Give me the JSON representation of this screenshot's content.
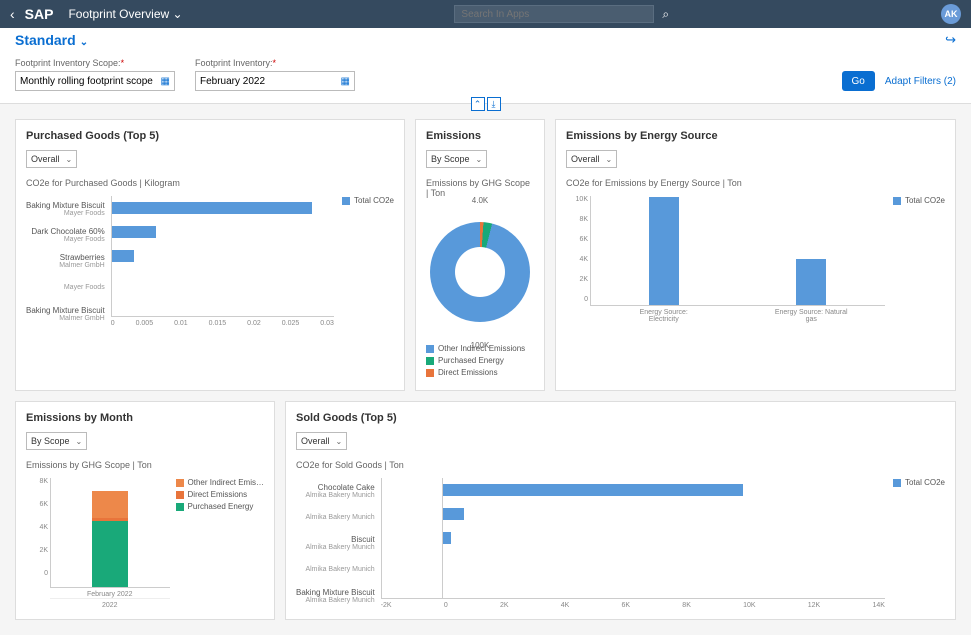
{
  "header": {
    "title": "Footprint Overview",
    "search_placeholder": "Search In Apps",
    "avatar": "AK"
  },
  "variant": {
    "name": "Standard"
  },
  "filters": {
    "scope_label": "Footprint Inventory Scope:",
    "scope_value": "Monthly rolling footprint scope",
    "inventory_label": "Footprint Inventory:",
    "inventory_value": "February 2022",
    "go": "Go",
    "adapt": "Adapt Filters (2)"
  },
  "cards": {
    "purchased": {
      "title": "Purchased Goods (Top 5)",
      "select": "Overall",
      "subtitle": "CO2e for Purchased Goods | Kilogram",
      "legend": "Total CO2e"
    },
    "emissions": {
      "title": "Emissions",
      "select": "By Scope",
      "subtitle": "Emissions by GHG Scope | Ton",
      "top_label": "4.0K",
      "bot_label": "100K",
      "legend1": "Other Indirect Emissions",
      "legend2": "Purchased Energy",
      "legend3": "Direct Emissions"
    },
    "energy": {
      "title": "Emissions by Energy Source",
      "select": "Overall",
      "subtitle": "CO2e for Emissions by Energy Source | Ton",
      "legend": "Total CO2e"
    },
    "bymonth": {
      "title": "Emissions by Month",
      "select": "By Scope",
      "subtitle": "Emissions by GHG Scope | Ton",
      "legend1": "Other Indirect Emis…",
      "legend2": "Direct Emissions",
      "legend3": "Purchased Energy",
      "xlabel1": "February 2022",
      "xgroup": "2022"
    },
    "sold": {
      "title": "Sold Goods (Top 5)",
      "select": "Overall",
      "subtitle": "CO2e for Sold Goods | Ton",
      "legend": "Total CO2e"
    }
  },
  "chart_data": [
    {
      "id": "purchased_goods",
      "type": "bar",
      "orientation": "horizontal",
      "title": "CO2e for Purchased Goods | Kilogram",
      "xlabel": "",
      "ylabel": "",
      "xlim": [
        0,
        0.03
      ],
      "xticks": [
        0,
        0.005,
        0.01,
        0.015,
        0.02,
        0.025,
        0.03
      ],
      "categories": [
        {
          "name": "Baking Mixture Biscuit",
          "sub": "Mayer Foods"
        },
        {
          "name": "Dark Chocolate 60%",
          "sub": "Mayer Foods"
        },
        {
          "name": "Strawberries",
          "sub": "Malmer GmbH"
        },
        {
          "name": "",
          "sub": "Mayer Foods"
        },
        {
          "name": "Baking Mixture Biscuit",
          "sub": "Malmer GmbH"
        }
      ],
      "series": [
        {
          "name": "Total CO2e",
          "color": "#5899da",
          "values": [
            0.027,
            0.006,
            0.003,
            0.0,
            0.0
          ]
        }
      ]
    },
    {
      "id": "emissions_scope",
      "type": "pie",
      "title": "Emissions by GHG Scope | Ton",
      "series": [
        {
          "name": "Other Indirect Emissions",
          "value": 100000,
          "color": "#5899da"
        },
        {
          "name": "Purchased Energy",
          "value": 3000,
          "color": "#19a979"
        },
        {
          "name": "Direct Emissions",
          "value": 1000,
          "color": "#e8743b"
        }
      ]
    },
    {
      "id": "energy_source",
      "type": "bar",
      "orientation": "vertical",
      "title": "CO2e for Emissions by Energy Source | Ton",
      "ylim": [
        0,
        10000
      ],
      "yticks": [
        0,
        2000,
        4000,
        6000,
        8000,
        10000
      ],
      "ytick_labels": [
        "0",
        "2K",
        "4K",
        "6K",
        "8K",
        "10K"
      ],
      "categories": [
        "Energy Source: Electricity",
        "Energy Source: Natural gas"
      ],
      "series": [
        {
          "name": "Total CO2e",
          "color": "#5899da",
          "values": [
            9800,
            4200
          ]
        }
      ]
    },
    {
      "id": "emissions_by_month",
      "type": "bar",
      "stacked": true,
      "orientation": "vertical",
      "title": "Emissions by GHG Scope | Ton",
      "ylim": [
        0,
        8000
      ],
      "yticks": [
        0,
        2000,
        4000,
        6000,
        8000
      ],
      "ytick_labels": [
        "0",
        "2K",
        "4K",
        "6K",
        "8K"
      ],
      "categories": [
        "February 2022"
      ],
      "group": "2022",
      "series": [
        {
          "name": "Purchased Energy",
          "color": "#19a979",
          "values": [
            4800
          ]
        },
        {
          "name": "Direct Emissions",
          "color": "#e8743b",
          "values": [
            200
          ]
        },
        {
          "name": "Other Indirect Emis…",
          "color": "#ed884a",
          "values": [
            2000
          ]
        }
      ]
    },
    {
      "id": "sold_goods",
      "type": "bar",
      "orientation": "horizontal",
      "title": "CO2e for Sold Goods | Ton",
      "xlim": [
        -2000,
        14000
      ],
      "xticks": [
        -2000,
        0,
        2000,
        4000,
        6000,
        8000,
        10000,
        12000,
        14000
      ],
      "xtick_labels": [
        "-2K",
        "0",
        "2K",
        "4K",
        "6K",
        "8K",
        "10K",
        "12K",
        "14K"
      ],
      "categories": [
        {
          "name": "Chocolate Cake",
          "sub": "Almika Bakery Munich"
        },
        {
          "name": "",
          "sub": "Almika Bakery Munich"
        },
        {
          "name": "Biscuit",
          "sub": "Almika Bakery Munich"
        },
        {
          "name": "",
          "sub": "Almika Bakery Munich"
        },
        {
          "name": "Baking Mixture Biscuit",
          "sub": "Almika Bakery Munich"
        }
      ],
      "series": [
        {
          "name": "Total CO2e",
          "color": "#5899da",
          "values": [
            9500,
            700,
            300,
            0,
            0
          ]
        }
      ]
    }
  ]
}
